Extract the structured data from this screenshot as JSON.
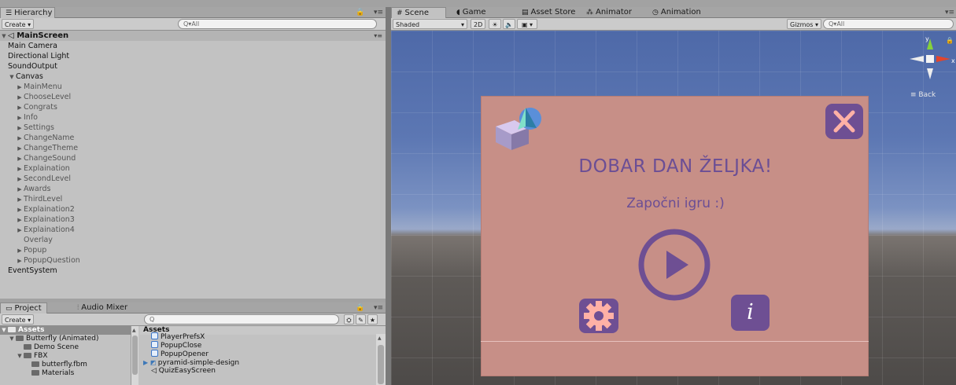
{
  "hierarchy": {
    "tab_label": "Hierarchy",
    "tab_icon": "list-icon",
    "create_label": "Create ▾",
    "search_placeholder": "Q▾All",
    "scene_name": "MainScreen",
    "items": [
      {
        "label": "Main Camera",
        "depth": 1,
        "expandable": false
      },
      {
        "label": "Directional Light",
        "depth": 1,
        "expandable": false
      },
      {
        "label": "SoundOutput",
        "depth": 1,
        "expandable": false
      },
      {
        "label": "Canvas",
        "depth": 1,
        "expandable": true,
        "expanded": true
      },
      {
        "label": "MainMenu",
        "depth": 2,
        "expandable": true
      },
      {
        "label": "ChooseLevel",
        "depth": 2,
        "expandable": true
      },
      {
        "label": "Congrats",
        "depth": 2,
        "expandable": true
      },
      {
        "label": "Info",
        "depth": 2,
        "expandable": true
      },
      {
        "label": "Settings",
        "depth": 2,
        "expandable": true
      },
      {
        "label": "ChangeName",
        "depth": 2,
        "expandable": true
      },
      {
        "label": "ChangeTheme",
        "depth": 2,
        "expandable": true
      },
      {
        "label": "ChangeSound",
        "depth": 2,
        "expandable": true
      },
      {
        "label": "Explaination",
        "depth": 2,
        "expandable": true
      },
      {
        "label": "SecondLevel",
        "depth": 2,
        "expandable": true
      },
      {
        "label": "Awards",
        "depth": 2,
        "expandable": true
      },
      {
        "label": "ThirdLevel",
        "depth": 2,
        "expandable": true
      },
      {
        "label": "Explaination2",
        "depth": 2,
        "expandable": true
      },
      {
        "label": "Explaination3",
        "depth": 2,
        "expandable": true
      },
      {
        "label": "Explaination4",
        "depth": 2,
        "expandable": true
      },
      {
        "label": "Overlay",
        "depth": 2,
        "expandable": false
      },
      {
        "label": "Popup",
        "depth": 2,
        "expandable": true
      },
      {
        "label": "PopupQuestion",
        "depth": 2,
        "expandable": true
      },
      {
        "label": "EventSystem",
        "depth": 1,
        "expandable": false
      }
    ]
  },
  "project": {
    "tab_label": "Project",
    "audio_tab_label": "Audio Mixer",
    "create_label": "Create ▾",
    "search_placeholder": "Q",
    "tree_root": "Assets",
    "tree": [
      {
        "label": "Butterfly (Animated)",
        "depth": 1
      },
      {
        "label": "Demo Scene",
        "depth": 2
      },
      {
        "label": "FBX",
        "depth": 2
      },
      {
        "label": "butterfly.fbm",
        "depth": 3
      },
      {
        "label": "Materials",
        "depth": 3
      }
    ],
    "content_header": "Assets",
    "files": [
      {
        "label": "PlayerPrefsX",
        "type": "script-icon"
      },
      {
        "label": "PopupClose",
        "type": "script-icon"
      },
      {
        "label": "PopupOpener",
        "type": "script-icon"
      },
      {
        "label": "pyramid-simple-design",
        "type": "prefab-icon"
      },
      {
        "label": "QuizEasyScreen",
        "type": "unity-scene-icon"
      }
    ]
  },
  "scene_view": {
    "tabs": [
      {
        "label": "Scene",
        "icon": "grid-icon",
        "active": true
      },
      {
        "label": "Game",
        "icon": "pacman-icon",
        "active": false
      },
      {
        "label": "Asset Store",
        "icon": "shop-icon",
        "active": false
      },
      {
        "label": "Animator",
        "icon": "animator-icon",
        "active": false
      },
      {
        "label": "Animation",
        "icon": "clock-icon",
        "active": false
      }
    ],
    "shading_mode": "Shaded",
    "mode_2d": "2D",
    "gizmos_label": "Gizmos ▾",
    "search_placeholder": "Q▾All",
    "gizmo_back_label": "≡ Back",
    "gizmo_y": "y",
    "gizmo_x": "x"
  },
  "popup": {
    "title": "DOBAR DAN ŽELJKA!",
    "subtitle": "Započni igru :)",
    "info_glyph": "i",
    "colors": {
      "panel": "#c78f87",
      "accent": "#6e4f93",
      "gear": "#ffb1a6"
    }
  }
}
